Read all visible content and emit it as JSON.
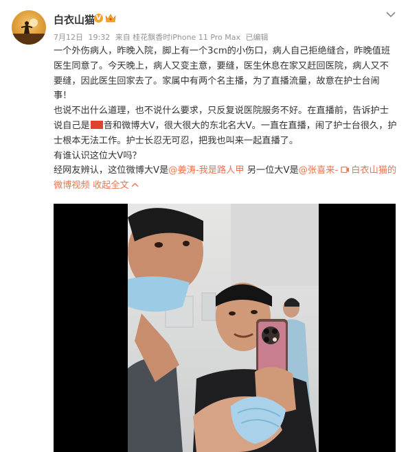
{
  "user": {
    "name": "白衣山猫",
    "verified_badge": "V",
    "avatar_icon": "avatar-sunset-silhouette",
    "member_badge_icon": "crown-badge-icon"
  },
  "meta": {
    "date": "7月12日",
    "time": "19:32",
    "source": "来自 桂花飘香时iPhone 11 Pro Max",
    "edited": "已编辑"
  },
  "post": {
    "p1": "一个外伤病人，昨晚入院，脚上有一个3cm的小伤口，病人自己拒绝缝合，昨晚值班医生同意了。今天晚上，病人又变主意，要缝，医生休息在家又赶回医院，病人又不要缝，因此医生回家去了。家属中有两个名主播，为了直播流量，故意在护士台闹事！",
    "p2_a": "也说不出什么道理，也不说什么要求，只反复说医院服务不好。在直播前，告诉护士说自己是",
    "p2_b": "音和微博大V，很大很大的东北名大V。一直在直播，闹了护士台很久，护士根本无法工作。护士长忍无可忍，把我也叫来一起直播了。",
    "p3": "有谁认识这位大V吗？",
    "p4_a": "经网友辨认，这位微博大V是",
    "mention1": "@姜涛-我是路人甲",
    "p4_b": " 另一位大V是",
    "mention2": "@张喜来-",
    "video_link": "白衣山猫的微博视频",
    "collapse": "收起全文"
  },
  "colors": {
    "link": "#eb7350",
    "meta": "#939393",
    "text": "#333333",
    "badge": "#f3a42a"
  }
}
